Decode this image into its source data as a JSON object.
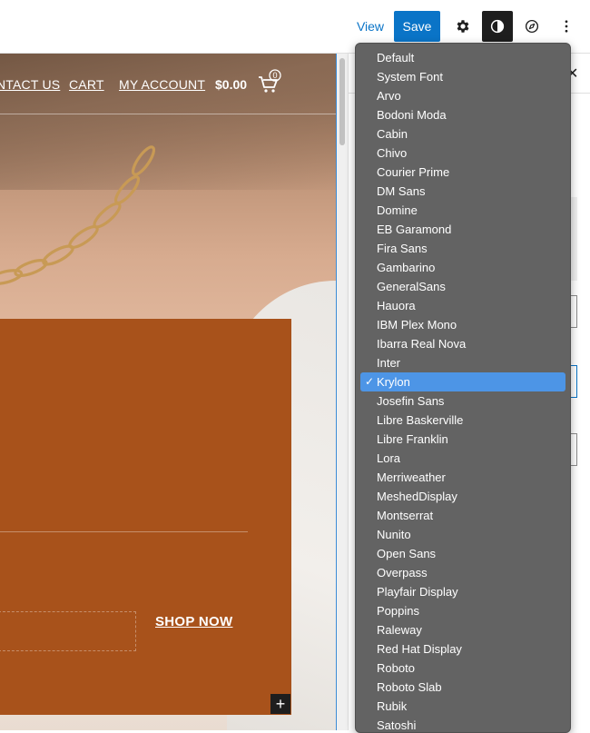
{
  "toolbar": {
    "view_label": "View",
    "save_label": "Save",
    "accent": "#0a74c7",
    "icons": [
      "gear-icon",
      "contrast-icon",
      "compass-icon",
      "more-vertical-icon"
    ]
  },
  "site_nav": {
    "links": [
      "NTACT US",
      "CART",
      "MY ACCOUNT"
    ],
    "cart_total": "$0.00",
    "cart_count": "0"
  },
  "promo": {
    "cta_label": "SHOP NOW",
    "background": "#a8521b"
  },
  "font_dropdown": {
    "selected": "Krylon",
    "options": [
      "Default",
      "System Font",
      "Arvo",
      "Bodoni Moda",
      "Cabin",
      "Chivo",
      "Courier Prime",
      "DM Sans",
      "Domine",
      "EB Garamond",
      "Fira Sans",
      "Gambarino",
      "GeneralSans",
      "Hauora",
      "IBM Plex Mono",
      "Ibarra Real Nova",
      "Inter",
      "Krylon",
      "Josefin Sans",
      "Libre Baskerville",
      "Libre Franklin",
      "Lora",
      "Merriweather",
      "MeshedDisplay",
      "Montserrat",
      "Nunito",
      "Open Sans",
      "Overpass",
      "Playfair Display",
      "Poppins",
      "Raleway",
      "Red Hat Display",
      "Roboto",
      "Roboto Slab",
      "Rubik",
      "Satoshi"
    ],
    "highlight_color": "#4d95e6"
  }
}
